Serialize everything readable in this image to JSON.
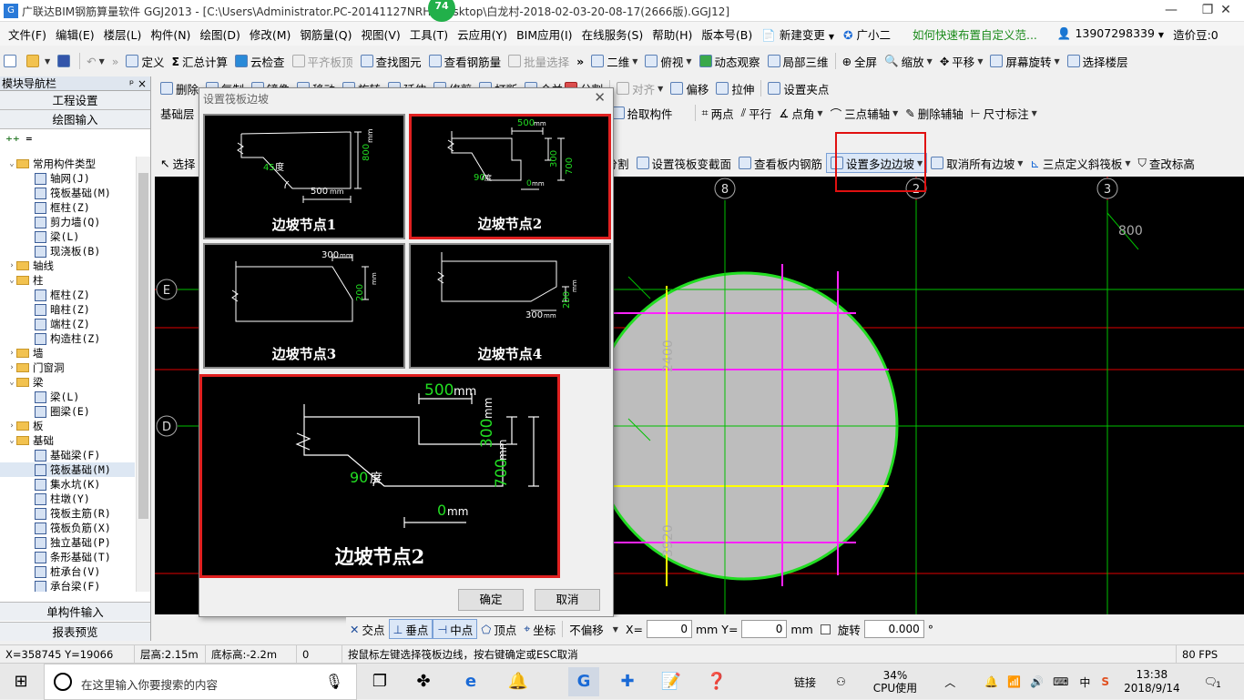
{
  "titlebar": {
    "title": "广联达BIM钢筋算量软件 GGJ2013 - [C:\\Users\\Administrator.PC-20141127NRHI\\Desktop\\白龙村-2018-02-03-20-08-17(2666版).GGJ12]",
    "badge": "74",
    "min": "—",
    "restore": "❐",
    "close": "✕"
  },
  "menu": {
    "items": [
      "文件(F)",
      "编辑(E)",
      "楼层(L)",
      "构件(N)",
      "绘图(D)",
      "修改(M)",
      "钢筋量(Q)",
      "视图(V)",
      "工具(T)",
      "云应用(Y)",
      "BIM应用(I)",
      "在线服务(S)",
      "帮助(H)",
      "版本号(B)"
    ],
    "new_change": "新建变更",
    "assistant": "广小二",
    "tip_link": "如何快速布置自定义范...",
    "phone": "13907298339",
    "price": "造价豆:0"
  },
  "toolbar1": {
    "define": "定义",
    "sum": "汇总计算",
    "cloud_check": "云检查",
    "flat_top": "平齐板顶",
    "find": "查找图元",
    "view_rebar": "查看钢筋量",
    "batch_select": "批量选择",
    "view_2d": "二维",
    "top_view": "俯视",
    "dynamic": "动态观察",
    "local_3d": "局部三维",
    "fullscreen": "全屏",
    "zoom": "缩放",
    "pan": "平移",
    "rotate_screen": "屏幕旋转",
    "select_floor": "选择楼层"
  },
  "toolbar2": {
    "delete": "删除",
    "copy": "复制",
    "mirror": "镜像",
    "move": "移动",
    "rotate": "旋转",
    "extend": "延伸",
    "trim": "修剪",
    "break": "打断",
    "merge": "合并",
    "split": "分割",
    "align": "对齐",
    "offset": "偏移",
    "stretch": "拉伸",
    "set_grip": "设置夹点"
  },
  "toolbar3": {
    "layer": "基础层",
    "pick": "拾取构件",
    "two_point": "两点",
    "parallel": "平行",
    "point_angle": "点角",
    "three_point_axis": "三点辅轴",
    "delete_axis": "删除辅轴",
    "dim": "尺寸标注"
  },
  "toolbar4": {
    "select": "选择",
    "split": "按梁分割",
    "set_section": "设置筏板变截面",
    "view_rebar": "查看板内钢筋",
    "set_multi_slope": "设置多边边坡",
    "cancel_slope": "取消所有边坡",
    "three_point_slope": "三点定义斜筏板",
    "edit_elev": "查改标高"
  },
  "nav": {
    "header": "模块导航栏",
    "pin": "ᵖ ×",
    "project_settings": "工程设置",
    "drawing_input": "绘图输入",
    "single_input": "单构件输入",
    "report": "报表预览",
    "tree": [
      {
        "label": "常用构件类型",
        "type": "folder",
        "level": 1,
        "open": true
      },
      {
        "label": "轴网(J)",
        "type": "leaf",
        "level": 2
      },
      {
        "label": "筏板基础(M)",
        "type": "leaf",
        "level": 2
      },
      {
        "label": "框柱(Z)",
        "type": "leaf",
        "level": 2
      },
      {
        "label": "剪力墙(Q)",
        "type": "leaf",
        "level": 2
      },
      {
        "label": "梁(L)",
        "type": "leaf",
        "level": 2
      },
      {
        "label": "现浇板(B)",
        "type": "leaf",
        "level": 2
      },
      {
        "label": "轴线",
        "type": "folder",
        "level": 1,
        "open": false
      },
      {
        "label": "柱",
        "type": "folder",
        "level": 1,
        "open": true
      },
      {
        "label": "框柱(Z)",
        "type": "leaf",
        "level": 2
      },
      {
        "label": "暗柱(Z)",
        "type": "leaf",
        "level": 2
      },
      {
        "label": "端柱(Z)",
        "type": "leaf",
        "level": 2
      },
      {
        "label": "构造柱(Z)",
        "type": "leaf",
        "level": 2
      },
      {
        "label": "墙",
        "type": "folder",
        "level": 1,
        "open": false
      },
      {
        "label": "门窗洞",
        "type": "folder",
        "level": 1,
        "open": false
      },
      {
        "label": "梁",
        "type": "folder",
        "level": 1,
        "open": true
      },
      {
        "label": "梁(L)",
        "type": "leaf",
        "level": 2
      },
      {
        "label": "圈梁(E)",
        "type": "leaf",
        "level": 2
      },
      {
        "label": "板",
        "type": "folder",
        "level": 1,
        "open": false
      },
      {
        "label": "基础",
        "type": "folder",
        "level": 1,
        "open": true
      },
      {
        "label": "基础梁(F)",
        "type": "leaf",
        "level": 2
      },
      {
        "label": "筏板基础(M)",
        "type": "leaf",
        "level": 2,
        "selected": true
      },
      {
        "label": "集水坑(K)",
        "type": "leaf",
        "level": 2
      },
      {
        "label": "柱墩(Y)",
        "type": "leaf",
        "level": 2
      },
      {
        "label": "筏板主筋(R)",
        "type": "leaf",
        "level": 2
      },
      {
        "label": "筏板负筋(X)",
        "type": "leaf",
        "level": 2
      },
      {
        "label": "独立基础(P)",
        "type": "leaf",
        "level": 2
      },
      {
        "label": "条形基础(T)",
        "type": "leaf",
        "level": 2
      },
      {
        "label": "桩承台(V)",
        "type": "leaf",
        "level": 2
      },
      {
        "label": "承台梁(F)",
        "type": "leaf",
        "level": 2
      }
    ]
  },
  "dialog": {
    "title": "设置筏板边坡",
    "close": "✕",
    "options": [
      {
        "caption": "边坡节点1",
        "w1": "800",
        "w1_unit": "mm",
        "angle": "45",
        "angle_unit": "度",
        "w2": "500",
        "w2_unit": "mm"
      },
      {
        "caption": "边坡节点2",
        "top": "500",
        "top_unit": "mm",
        "h1": "300",
        "h1_unit": "mm",
        "h2": "700",
        "h2_unit": "mm",
        "angle": "90",
        "angle_unit": "度",
        "bottom": "0",
        "bottom_unit": "mm"
      },
      {
        "caption": "边坡节点3",
        "top": "300",
        "top_unit": "mm",
        "h": "200",
        "h_unit": "mm"
      },
      {
        "caption": "边坡节点4",
        "bottom": "300",
        "bottom_unit": "mm",
        "h": "200",
        "h_unit": "mm"
      }
    ],
    "selected_index": 1,
    "preview": {
      "caption": "边坡节点2",
      "top": "500",
      "top_unit": "mm",
      "h1": "300",
      "h1_unit": "mm",
      "h2": "700",
      "h2_unit": "mm",
      "angle": "90",
      "angle_unit": "度",
      "bottom": "0",
      "bottom_unit": "mm"
    },
    "ok": "确定",
    "cancel": "取消"
  },
  "canvas": {
    "axis_labels": [
      "8",
      "2",
      "3",
      "E",
      "D"
    ],
    "dims": [
      "800",
      "2400",
      "3920"
    ],
    "colors": {
      "bg": "#000000",
      "grid": "#e00000",
      "green": "#22dd22",
      "yellow": "#ffff00",
      "magenta": "#ff22ff",
      "fill": "#bdbdbd",
      "axis": "#00c000"
    }
  },
  "snap": {
    "intersection": "交点",
    "perpendicular": "垂点",
    "midpoint": "中点",
    "vertex": "顶点",
    "coordinate": "坐标",
    "offset_mode": "不偏移",
    "x_label": "X=",
    "x_value": "0",
    "y_label": "mm Y=",
    "y_value": "0",
    "mm": "mm",
    "rotate": "旋转",
    "rotate_value": "0.000",
    "degree": "°"
  },
  "status": {
    "coords": "X=358745 Y=19066",
    "floor_height": "层高:2.15m",
    "base_elev": "底标高:-2.2m",
    "zero": "0",
    "hint": "按鼠标左键选择筏板边线，按右键确定或ESC取消",
    "fps": "80 FPS"
  },
  "taskbar": {
    "search_placeholder": "在这里输入你要搜索的内容",
    "link": "链接",
    "cpu_percent": "34%",
    "cpu_label": "CPU使用",
    "ime": "中",
    "time": "13:38",
    "date": "2018/9/14",
    "notif": "1"
  }
}
